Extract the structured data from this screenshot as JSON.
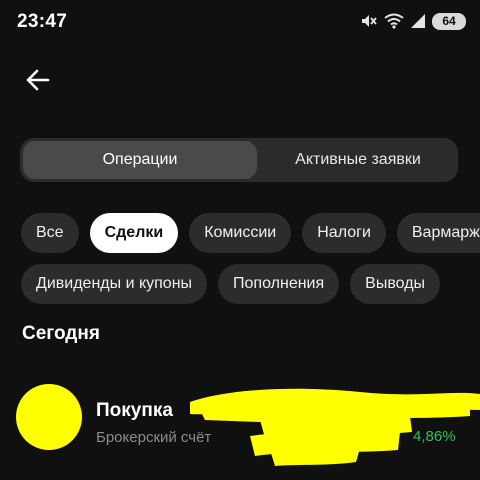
{
  "status_bar": {
    "time": "23:47",
    "battery": "64",
    "icons": [
      "mute-icon",
      "wifi-icon",
      "signal-icon",
      "battery-icon"
    ]
  },
  "header": {
    "back_icon": "arrow-left-icon"
  },
  "tabs": [
    {
      "label": "Операции",
      "selected": true
    },
    {
      "label": "Активные заявки",
      "selected": false
    }
  ],
  "filters_row1": [
    {
      "label": "Все",
      "selected": false
    },
    {
      "label": "Сделки",
      "selected": true
    },
    {
      "label": "Комиссии",
      "selected": false
    },
    {
      "label": "Налоги",
      "selected": false
    },
    {
      "label": "Вармаржа",
      "selected": false
    }
  ],
  "filters_row2": [
    {
      "label": "Дивиденды и купоны",
      "selected": false
    },
    {
      "label": "Пополнения",
      "selected": false
    },
    {
      "label": "Выводы",
      "selected": false
    }
  ],
  "section": {
    "title": "Сегодня"
  },
  "transaction": {
    "title": "Покупка",
    "subtitle": "Брокерский счёт",
    "change": "4,86%"
  },
  "colors": {
    "background": "#101010",
    "accent_yellow": "#ffff00",
    "positive_green": "#2fc25b",
    "chip_bg": "#2c2c2c",
    "chip_selected_bg": "#ffffff"
  }
}
